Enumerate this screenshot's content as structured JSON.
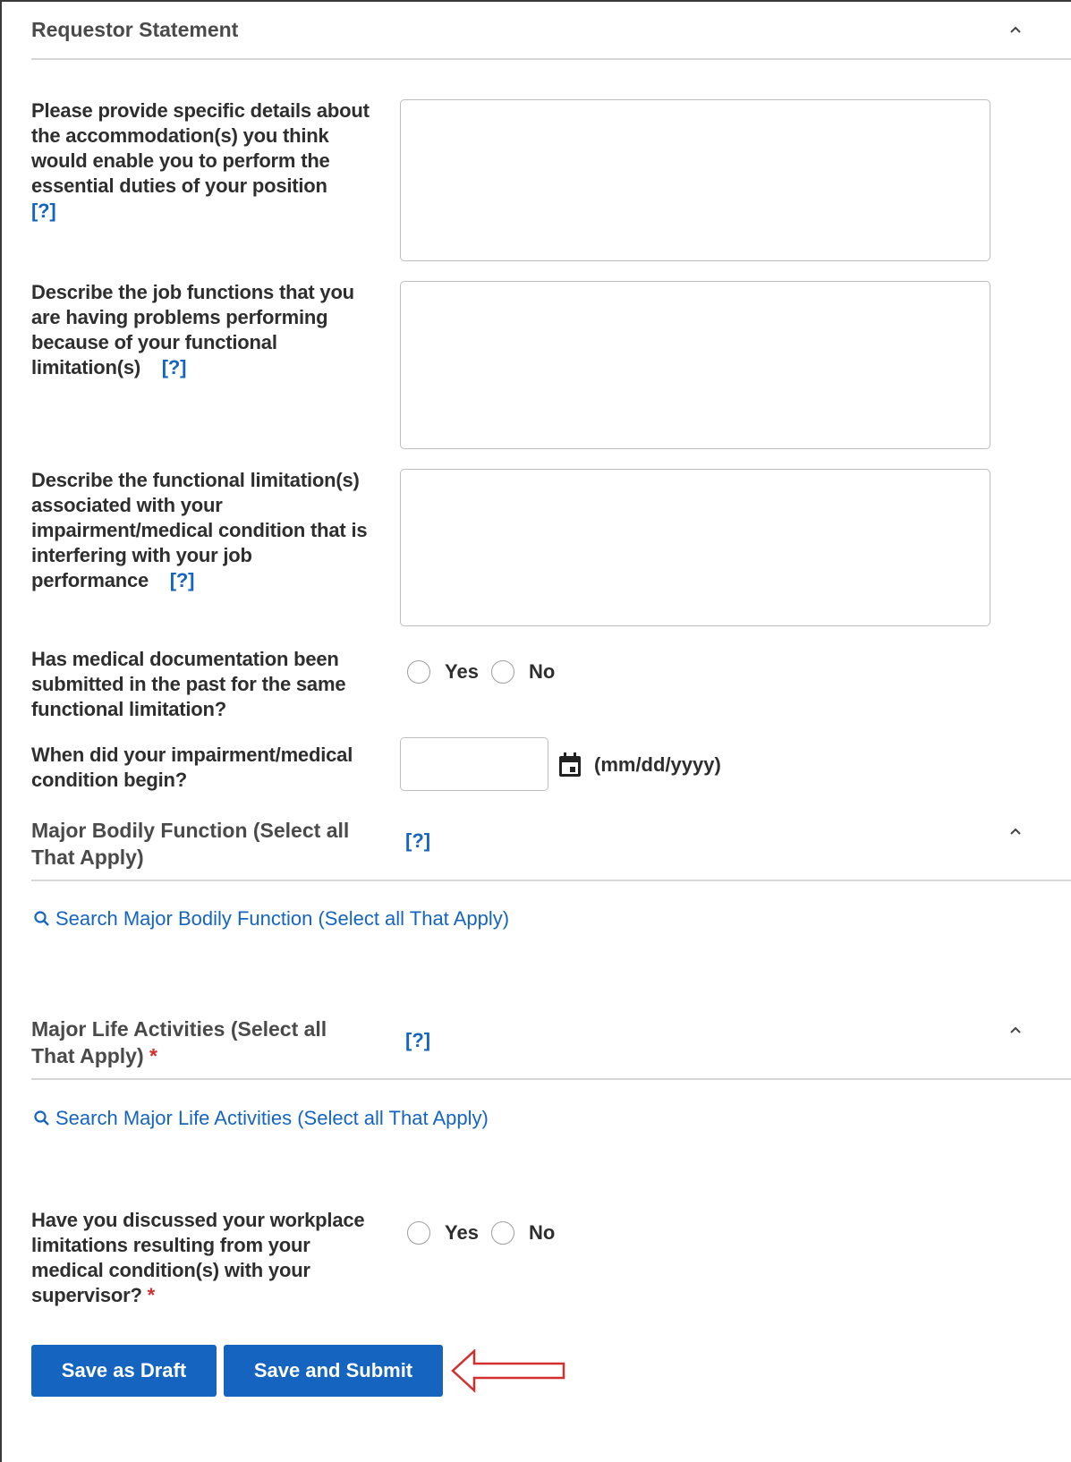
{
  "section": {
    "title": "Requestor Statement"
  },
  "help_marker": "[?]",
  "required_marker": "*",
  "questions": {
    "accommodation": "Please provide specific details about the accommodation(s) you think would enable you to perform the essential duties of your position",
    "job_functions": "Describe the job functions that you are having problems performing because of your functional limitation(s)",
    "functional_limitations": "Describe the functional limitation(s) associated with your impairment/medical condition that is interfering with your job performance",
    "medical_documentation": "Has medical documentation been submitted in the past for the same functional limitation?",
    "condition_begin": "When did your impairment/medical condition begin?",
    "discussed_supervisor": "Have you discussed your workplace limitations resulting from your medical condition(s) with your supervisor?"
  },
  "radio": {
    "yes": "Yes",
    "no": "No"
  },
  "date": {
    "format_hint": "(mm/dd/yyyy)",
    "value": ""
  },
  "bodily_function": {
    "title": "Major Bodily Function (Select all That Apply)",
    "search_label": "Search Major Bodily Function (Select all That Apply)"
  },
  "life_activities": {
    "title": "Major Life Activities (Select all That Apply)",
    "search_label": "Search Major Life Activities (Select all That Apply)"
  },
  "buttons": {
    "save_draft": "Save as Draft",
    "save_submit": "Save and Submit"
  },
  "colors": {
    "accent": "#1565c0",
    "required": "#d32f2f",
    "annotation_arrow": "#d32f2f"
  },
  "icons": {
    "collapse": "chevron-up-icon",
    "calendar": "calendar-icon",
    "search": "search-icon",
    "annotation": "arrow-left-icon"
  }
}
